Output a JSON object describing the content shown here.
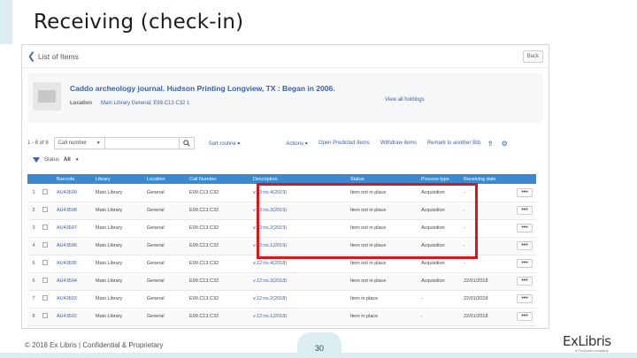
{
  "slide": {
    "title": "Receiving (check-in)",
    "footer": "© 2018 Ex Libris | Confidential & Proprietary",
    "page_number": "30",
    "logo_text": "ExLibris",
    "logo_sub": "a ProQuest company"
  },
  "header": {
    "title": "List of Items",
    "back_label": "Back"
  },
  "record": {
    "title": "Caddo archeology journal. Hudson Printing Longview, TX : Began in 2006.",
    "location_label": "Location",
    "location_value": "Main Library General; E99.C13 C32 1",
    "view_holdings": "View all holdings"
  },
  "toolbar": {
    "count": "1 - 8 of 8",
    "search_field": "Call number",
    "search_value": "",
    "sort": "Sort routine",
    "actions": "Actions",
    "open_predicted": "Open Predicted Items",
    "withdraw": "Withdraw items",
    "remark": "Remark to another Bib"
  },
  "filter": {
    "label": "Status",
    "value": "All"
  },
  "table": {
    "columns": [
      "",
      "",
      "Barcode",
      "Library",
      "Location",
      "Call Number",
      "Description",
      "Status",
      "Process type",
      "Receiving date",
      ""
    ],
    "rows": [
      {
        "n": "1",
        "barcode": "AU43699",
        "library": "Main Library",
        "location": "General",
        "call": "E99.C13 C32",
        "desc": "v.13:no.4(2019)",
        "status": "Item not in place",
        "ptype": "Acquisition",
        "date": "-"
      },
      {
        "n": "2",
        "barcode": "AU43698",
        "library": "Main Library",
        "location": "General",
        "call": "E99.C13 C32",
        "desc": "v.13:no.3(2019)",
        "status": "Item not in place",
        "ptype": "Acquisition",
        "date": "-"
      },
      {
        "n": "3",
        "barcode": "AU43697",
        "library": "Main Library",
        "location": "General",
        "call": "E99.C13 C32",
        "desc": "v.13:no.2(2019)",
        "status": "Item not in place",
        "ptype": "Acquisition",
        "date": "-"
      },
      {
        "n": "4",
        "barcode": "AU43696",
        "library": "Main Library",
        "location": "General",
        "call": "E99.C13 C32",
        "desc": "v.13:no.1(2019)",
        "status": "Item not in place",
        "ptype": "Acquisition",
        "date": "-"
      },
      {
        "n": "5",
        "barcode": "AU43695",
        "library": "Main Library",
        "location": "General",
        "call": "E99.C13 C32",
        "desc": "v.12:no.4(2018)",
        "status": "Item not in place",
        "ptype": "Acquisition",
        "date": "-"
      },
      {
        "n": "6",
        "barcode": "AU43694",
        "library": "Main Library",
        "location": "General",
        "call": "E99.C13 C32",
        "desc": "v.12:no.3(2018)",
        "status": "Item not in place",
        "ptype": "Acquisition",
        "date": "22/01/2018"
      },
      {
        "n": "7",
        "barcode": "AU43693",
        "library": "Main Library",
        "location": "General",
        "call": "E99.C13 C32",
        "desc": "v.12:no.2(2018)",
        "status": "Item in place",
        "ptype": "-",
        "date": "22/01/2018"
      },
      {
        "n": "8",
        "barcode": "AU43692",
        "library": "Main Library",
        "location": "General",
        "call": "E99.C13 C32",
        "desc": "v.12:no.1(2018)",
        "status": "Item in place",
        "ptype": "-",
        "date": "22/01/2018"
      }
    ],
    "more_label": "•••"
  },
  "colors": {
    "accent": "#3b8ad0",
    "link": "#3b5fa8",
    "highlight": "#d8161c",
    "slide_band": "#dceef2"
  }
}
